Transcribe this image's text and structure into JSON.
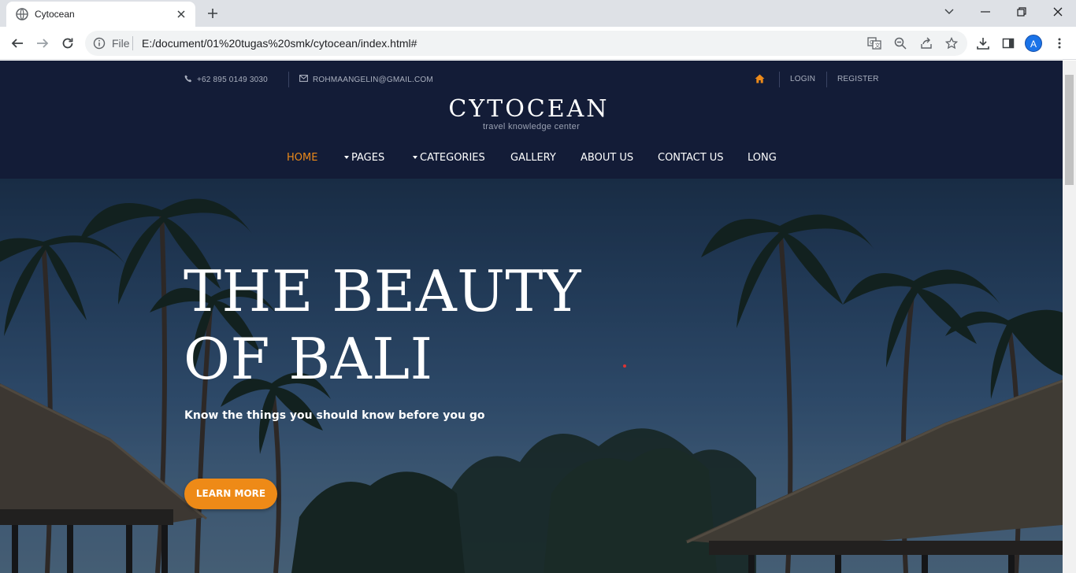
{
  "browser": {
    "tab_title": "Cytocean",
    "omnibox_scheme": "File",
    "url": "E:/document/01%20tugas%20smk/cytocean/index.html#",
    "avatar_letter": "A"
  },
  "site": {
    "topbar": {
      "phone": "+62 895 0149 3030",
      "email": "ROHMAANGELIN@GMAIL.COM",
      "login": "LOGIN",
      "register": "REGISTER"
    },
    "logo": {
      "name": "CYTOCEAN",
      "tagline": "travel knowledge center"
    },
    "nav": {
      "home": "HOME",
      "pages": "PAGES",
      "categories": "CATEGORIES",
      "gallery": "GALLERY",
      "about": "ABOUT US",
      "contact": "CONTACT US",
      "long": "LONG"
    },
    "hero": {
      "title_line1": "THE BEAUTY",
      "title_line2": "OF BALI",
      "subtitle": "Know the things you should know before you go",
      "button": "LEARN MORE"
    }
  },
  "colors": {
    "header_bg": "#131c37",
    "accent": "#ee8a17",
    "active_nav": "#ec8a1a"
  },
  "icons": [
    "globe-icon",
    "close-icon",
    "plus-icon",
    "chevron-down-icon",
    "minimize-icon",
    "restore-icon",
    "back-icon",
    "forward-icon",
    "reload-icon",
    "info-icon",
    "translate-icon",
    "zoom-icon",
    "share-icon",
    "star-icon",
    "download-icon",
    "side-panel-icon",
    "menu-icon",
    "phone-icon",
    "mail-icon",
    "home-icon"
  ]
}
